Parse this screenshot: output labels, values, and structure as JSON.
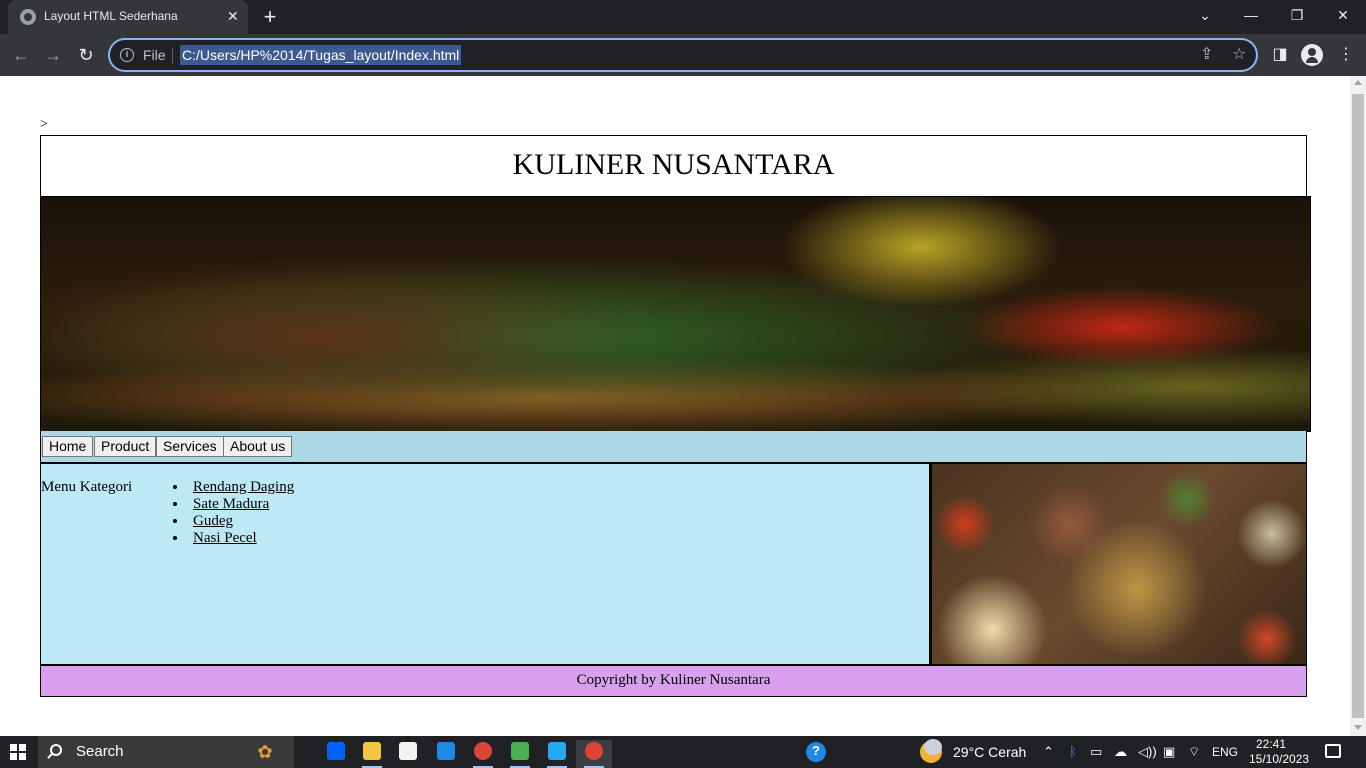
{
  "browser": {
    "tab_title": "Layout HTML Sederhana",
    "tab_close": "✕",
    "new_tab": "+",
    "controls": {
      "dropdown": "⌄",
      "minimize": "—",
      "restore": "❐",
      "close": "✕"
    },
    "nav": {
      "back": "←",
      "forward": "→",
      "reload": "↻"
    },
    "address": {
      "scheme_label": "File",
      "url": "C:/Users/HP%2014/Tugas_layout/Index.html"
    },
    "icons": [
      "info-icon",
      "share-icon",
      "star-icon",
      "side-panel-icon",
      "profile-icon",
      "menu-kebab-icon"
    ],
    "accent": "#8ab4f8"
  },
  "page": {
    "stray_text": ">",
    "site_title": "KULINER NUSANTARA",
    "nav_buttons": [
      "Home",
      "Product",
      "Services",
      "About us"
    ],
    "menu_label": "Menu Kategori",
    "menu_items": [
      "Rendang Daging",
      "Sate Madura",
      "Gudeg",
      "Nasi Pecel"
    ],
    "footer": "Copyright by Kuliner Nusantara",
    "colors": {
      "navbar_bg": "#add8e6",
      "content_bg": "#bde9f5",
      "footer_bg": "#d8a0ee"
    }
  },
  "taskbar": {
    "search_placeholder": "Search",
    "weather": "29°C  Cerah",
    "language": "ENG",
    "time": "22:41",
    "date": "15/10/2023",
    "pinned_apps": [
      "dropbox",
      "file-explorer",
      "microsoft-store",
      "mail",
      "chrome",
      "git",
      "vscode",
      "chrome-active"
    ],
    "tray_icons": [
      "help-icon",
      "chevron-up-icon",
      "bluetooth-icon",
      "battery-icon",
      "network-error-icon",
      "volume-icon",
      "display-icon",
      "wifi-icon",
      "notification-icon"
    ]
  }
}
